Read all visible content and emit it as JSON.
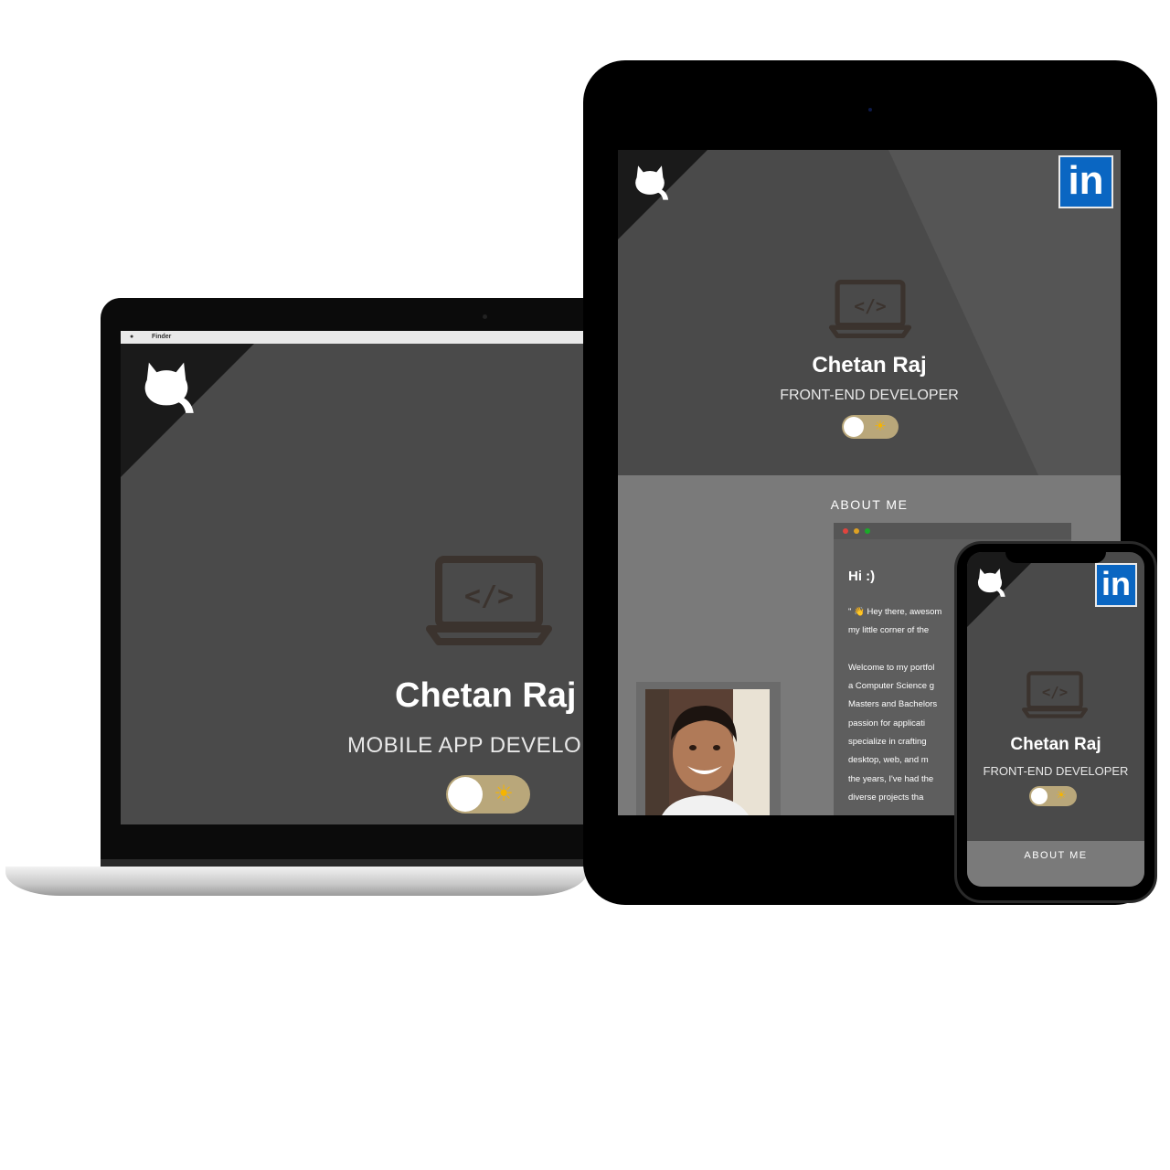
{
  "laptop": {
    "menubar": {
      "apple": "",
      "app": "Finder"
    },
    "hero": {
      "name": "Chetan Raj",
      "role": "MOBILE APP DEVELO",
      "toggle_icon": "sun-icon"
    }
  },
  "tablet": {
    "hero": {
      "name": "Chetan Raj",
      "role": "FRONT-END DEVELOPER",
      "toggle_icon": "sun-icon"
    },
    "linkedin_label": "in",
    "about": {
      "title": "ABOUT ME",
      "greeting": "Hi :)",
      "lines": [
        "\" 👋 Hey there, awesom",
        "my little corner of the",
        "",
        "Welcome to my portfol",
        "a  Computer  Science  g",
        "Masters and Bachelors",
        "passion    for    applicati",
        "specialize  in  crafting",
        "desktop,    web,    and   m",
        "the years, I've had the",
        "diverse     projects      tha"
      ]
    }
  },
  "phone": {
    "hero": {
      "name": "Chetan Raj",
      "role": "FRONT-END DEVELOPER",
      "toggle_icon": "sun-icon"
    },
    "linkedin_label": "in",
    "about_title": "ABOUT ME"
  },
  "colors": {
    "screen_bg": "#4a4a4a",
    "about_bg": "#7a7a7a",
    "corner": "#1a1a1a",
    "toggle_track": "#b9a77a",
    "linkedin_blue": "#0a66c2",
    "sun": "#f5b400"
  }
}
